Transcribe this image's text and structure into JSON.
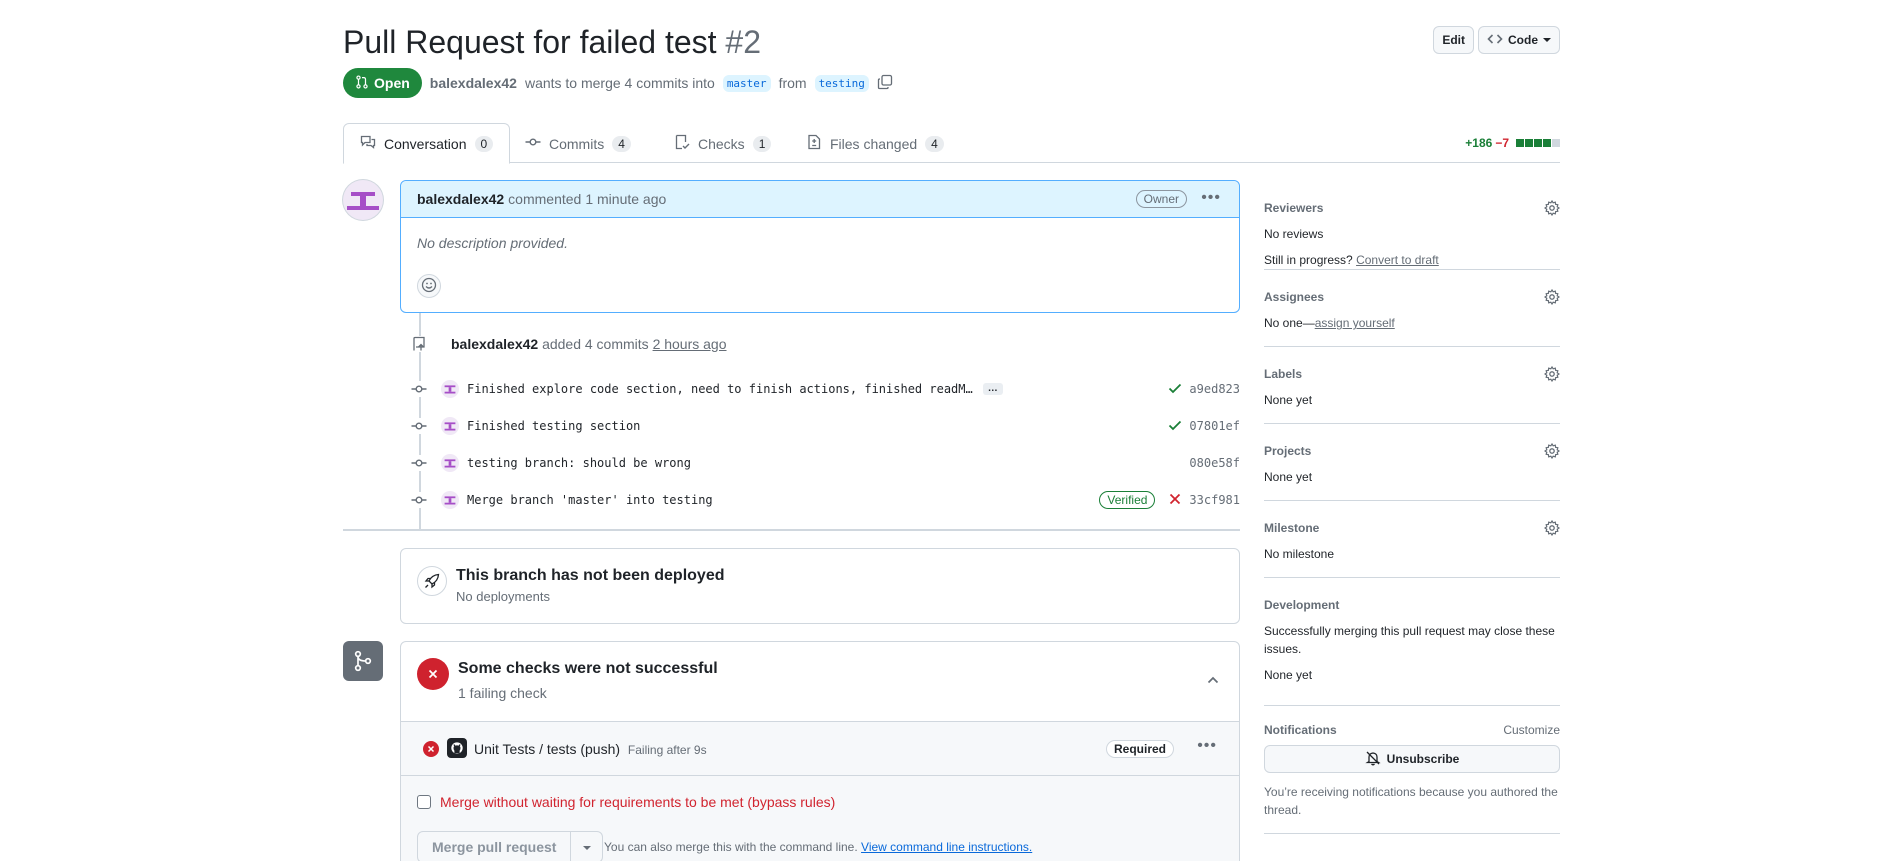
{
  "header": {
    "title": "Pull Request for failed test",
    "number": "#2",
    "edit_label": "Edit",
    "code_label": "Code"
  },
  "meta": {
    "state": "Open",
    "author": "balexdalex42",
    "text_before": "wants to merge 4 commits into",
    "base_branch": "master",
    "from_text": "from",
    "head_branch": "testing"
  },
  "tabs": [
    {
      "label": "Conversation",
      "count": "0"
    },
    {
      "label": "Commits",
      "count": "4"
    },
    {
      "label": "Checks",
      "count": "1"
    },
    {
      "label": "Files changed",
      "count": "4"
    }
  ],
  "diffstat": {
    "additions": "+186",
    "deletions": "−7"
  },
  "comment": {
    "author": "balexdalex42",
    "action": "commented",
    "time": "1 minute ago",
    "role": "Owner",
    "body": "No description provided."
  },
  "commits_event": {
    "author": "balexdalex42",
    "text": "added 4 commits",
    "time": "2 hours ago"
  },
  "commits": [
    {
      "message": "Finished explore code section, need to finish actions, finished readM…",
      "sha": "a9ed823",
      "status": "success"
    },
    {
      "message": "Finished testing section",
      "sha": "07801ef",
      "status": "success"
    },
    {
      "message": "testing branch: should be wrong",
      "sha": "080e58f",
      "status": "none"
    },
    {
      "message": "Merge branch 'master' into testing",
      "sha": "33cf981",
      "status": "failure",
      "badge": "Verified"
    }
  ],
  "deploy": {
    "title": "This branch has not been deployed",
    "subtitle": "No deployments"
  },
  "checks": {
    "title": "Some checks were not successful",
    "subtitle": "1 failing check",
    "item_name": "Unit Tests / tests (push)",
    "item_duration": "Failing after 9s",
    "item_badge": "Required"
  },
  "merge": {
    "bypass_label": "Merge without waiting for requirements to be met (bypass rules)",
    "button_label": "Merge pull request",
    "hint_text": "You can also merge this with the command line.",
    "hint_link": "View command line instructions."
  },
  "sidebar": {
    "reviewers": {
      "title": "Reviewers",
      "value": "No reviews",
      "progress_text": "Still in progress?",
      "progress_link": "Convert to draft"
    },
    "assignees": {
      "title": "Assignees",
      "value": "No one—",
      "link": "assign yourself"
    },
    "labels": {
      "title": "Labels",
      "value": "None yet"
    },
    "projects": {
      "title": "Projects",
      "value": "None yet"
    },
    "milestone": {
      "title": "Milestone",
      "value": "No milestone"
    },
    "development": {
      "title": "Development",
      "desc": "Successfully merging this pull request may close these issues.",
      "value": "None yet"
    },
    "notifications": {
      "title": "Notifications",
      "customize": "Customize",
      "button": "Unsubscribe",
      "desc": "You’re receiving notifications because you authored the thread."
    }
  },
  "colors": {
    "open": "#1f883d",
    "accent": "#0969da",
    "danger": "#cf222e",
    "success": "#1a7f37"
  }
}
